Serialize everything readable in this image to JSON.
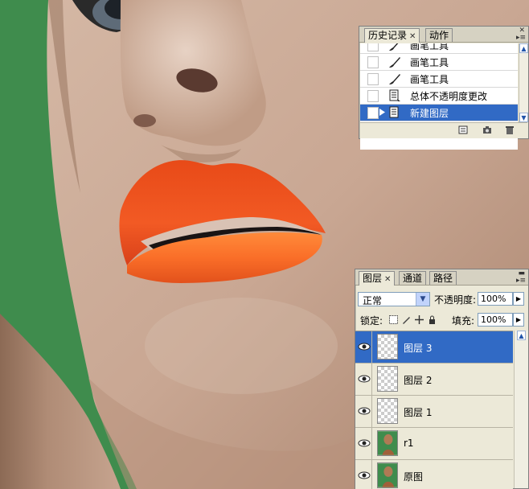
{
  "history_panel": {
    "tabs": [
      {
        "label": "历史记录",
        "active": true,
        "closable": true
      },
      {
        "label": "动作",
        "active": false,
        "closable": false
      }
    ],
    "items": [
      {
        "label": "画笔工具",
        "icon": "brush-icon",
        "selected": false
      },
      {
        "label": "画笔工具",
        "icon": "brush-icon",
        "selected": false
      },
      {
        "label": "画笔工具",
        "icon": "brush-icon",
        "selected": false
      },
      {
        "label": "总体不透明度更改",
        "icon": "document-icon",
        "selected": false
      },
      {
        "label": "新建图层",
        "icon": "document-icon",
        "selected": true
      }
    ],
    "footer_icons": [
      "new-document-from-state-icon",
      "snapshot-icon",
      "trash-icon"
    ]
  },
  "layers_panel": {
    "tabs": [
      {
        "label": "图层",
        "active": true,
        "closable": true
      },
      {
        "label": "通道",
        "active": false,
        "closable": false
      },
      {
        "label": "路径",
        "active": false,
        "closable": false
      }
    ],
    "blend_mode": "正常",
    "opacity_label": "不透明度:",
    "opacity_value": "100%",
    "lock_label": "锁定:",
    "fill_label": "填充:",
    "fill_value": "100%",
    "layers": [
      {
        "name": "图层 3",
        "thumb": "transparent",
        "selected": true,
        "visible": true
      },
      {
        "name": "图层 2",
        "thumb": "transparent",
        "selected": false,
        "visible": true
      },
      {
        "name": "图层 1",
        "thumb": "transparent",
        "selected": false,
        "visible": true
      },
      {
        "name": "r1",
        "thumb": "photo",
        "selected": false,
        "visible": true
      },
      {
        "name": "原图",
        "thumb": "photo",
        "selected": false,
        "visible": true
      }
    ]
  },
  "colors": {
    "selection": "#316ac5",
    "panel_bg": "#ece9d8",
    "background_green": "#3d8a4b",
    "lip_orange": "#f0541f"
  }
}
